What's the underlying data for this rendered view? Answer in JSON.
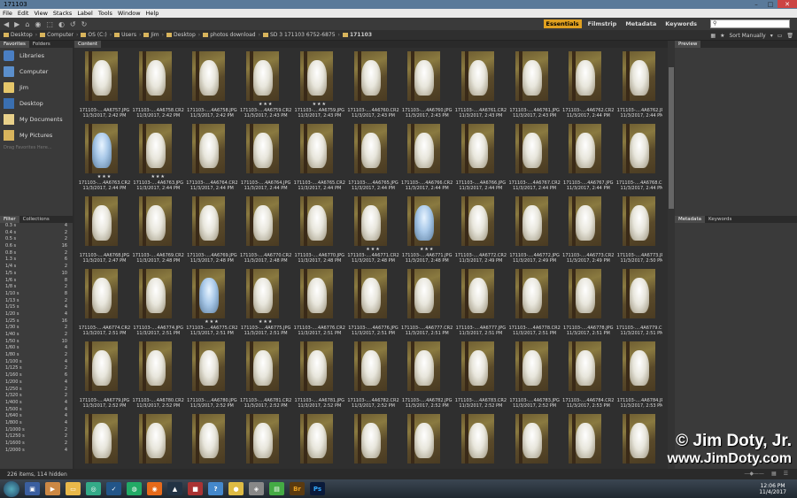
{
  "window": {
    "title": "171103"
  },
  "menu": [
    "File",
    "Edit",
    "View",
    "Stacks",
    "Label",
    "Tools",
    "Window",
    "Help"
  ],
  "workspaces": [
    "Essentials",
    "Filmstrip",
    "Metadata",
    "Keywords"
  ],
  "search": {
    "placeholder": ""
  },
  "path": [
    "Desktop",
    "Computer",
    "OS (C:)",
    "Users",
    "Jim",
    "Desktop",
    "photos download",
    "SD 3 171103 6752-6875",
    "171103"
  ],
  "view": {
    "sort": "Sort Manually"
  },
  "left_tabs": [
    "Favorites",
    "Folders"
  ],
  "favorites": [
    "Libraries",
    "Computer",
    "Jim",
    "Desktop",
    "My Documents",
    "My Pictures"
  ],
  "favorites_hint": "Drag Favorites Here...",
  "filter_tabs": [
    "Filter",
    "Collections"
  ],
  "filters": [
    [
      "0.3 s",
      "4"
    ],
    [
      "0.4 s",
      "2"
    ],
    [
      "0.5 s",
      "2"
    ],
    [
      "0.6 s",
      "16"
    ],
    [
      "0.8 s",
      "2"
    ],
    [
      "1.3 s",
      "6"
    ],
    [
      "1/4 s",
      "2"
    ],
    [
      "1/5 s",
      "10"
    ],
    [
      "1/6 s",
      "8"
    ],
    [
      "1/8 s",
      "2"
    ],
    [
      "1/10 s",
      "8"
    ],
    [
      "1/13 s",
      "2"
    ],
    [
      "1/15 s",
      "4"
    ],
    [
      "1/20 s",
      "4"
    ],
    [
      "1/25 s",
      "16"
    ],
    [
      "1/30 s",
      "2"
    ],
    [
      "1/40 s",
      "2"
    ],
    [
      "1/50 s",
      "10"
    ],
    [
      "1/60 s",
      "4"
    ],
    [
      "1/80 s",
      "2"
    ],
    [
      "1/100 s",
      "4"
    ],
    [
      "1/125 s",
      "2"
    ],
    [
      "1/160 s",
      "6"
    ],
    [
      "1/200 s",
      "4"
    ],
    [
      "1/250 s",
      "2"
    ],
    [
      "1/320 s",
      "2"
    ],
    [
      "1/400 s",
      "4"
    ],
    [
      "1/500 s",
      "4"
    ],
    [
      "1/640 s",
      "4"
    ],
    [
      "1/800 s",
      "4"
    ],
    [
      "1/1000 s",
      "2"
    ],
    [
      "1/1250 s",
      "2"
    ],
    [
      "1/1600 s",
      "2"
    ],
    [
      "1/2000 s",
      "4"
    ]
  ],
  "content_tab": "Content",
  "right_tabs_top": [
    "Preview"
  ],
  "right_tabs_bottom": [
    "Metadata",
    "Keywords"
  ],
  "thumbnails": [
    {
      "name": "171103-....4A6757.JPG",
      "date": "11/3/2017, 2:42 PM",
      "stars": ""
    },
    {
      "name": "171103-....4A6758.CR2",
      "date": "11/3/2017, 2:42 PM",
      "stars": ""
    },
    {
      "name": "171103-....4A6758.JPG",
      "date": "11/3/2017, 2:42 PM",
      "stars": ""
    },
    {
      "name": "171103-....4A6759.CR2",
      "date": "11/3/2017, 2:43 PM",
      "stars": "★★★"
    },
    {
      "name": "171103-....4A6759.JPG",
      "date": "11/3/2017, 2:43 PM",
      "stars": "★★★"
    },
    {
      "name": "171103-....4A6760.CR2",
      "date": "11/3/2017, 2:43 PM",
      "stars": ""
    },
    {
      "name": "171103-....4A6760.JPG",
      "date": "11/3/2017, 2:43 PM",
      "stars": ""
    },
    {
      "name": "171103-....4A6761.CR2",
      "date": "11/3/2017, 2:43 PM",
      "stars": ""
    },
    {
      "name": "171103-....4A6761.JPG",
      "date": "11/3/2017, 2:43 PM",
      "stars": ""
    },
    {
      "name": "171103-....4A6762.CR2",
      "date": "11/3/2017, 2:44 PM",
      "stars": ""
    },
    {
      "name": "171103-....4A6762.JPG",
      "date": "11/3/2017, 2:44 PM",
      "stars": ""
    },
    {
      "name": "171103-....4A6763.CR2",
      "date": "11/3/2017, 2:44 PM",
      "stars": "★★★"
    },
    {
      "name": "171103-....4A6763.JPG",
      "date": "11/3/2017, 2:44 PM",
      "stars": "★★★"
    },
    {
      "name": "171103-....4A6764.CR2",
      "date": "11/3/2017, 2:44 PM",
      "stars": ""
    },
    {
      "name": "171103-....4A6764.JPG",
      "date": "11/3/2017, 2:44 PM",
      "stars": ""
    },
    {
      "name": "171103-....4A6765.CR2",
      "date": "11/3/2017, 2:44 PM",
      "stars": ""
    },
    {
      "name": "171103-....4A6765.JPG",
      "date": "11/3/2017, 2:44 PM",
      "stars": ""
    },
    {
      "name": "171103-....4A6766.CR2",
      "date": "11/3/2017, 2:44 PM",
      "stars": ""
    },
    {
      "name": "171103-....4A6766.JPG",
      "date": "11/3/2017, 2:44 PM",
      "stars": ""
    },
    {
      "name": "171103-....4A6767.CR2",
      "date": "11/3/2017, 2:44 PM",
      "stars": ""
    },
    {
      "name": "171103-....4A6767.JPG",
      "date": "11/3/2017, 2:44 PM",
      "stars": ""
    },
    {
      "name": "171103-....4A6768.CR2",
      "date": "11/3/2017, 2:44 PM",
      "stars": ""
    },
    {
      "name": "171103-....4A6768.JPG",
      "date": "11/3/2017, 2:47 PM",
      "stars": ""
    },
    {
      "name": "171103-....4A6769.CR2",
      "date": "11/3/2017, 2:48 PM",
      "stars": ""
    },
    {
      "name": "171103-....4A6769.JPG",
      "date": "11/3/2017, 2:48 PM",
      "stars": ""
    },
    {
      "name": "171103-....4A6770.CR2",
      "date": "11/3/2017, 2:48 PM",
      "stars": ""
    },
    {
      "name": "171103-....4A6770.JPG",
      "date": "11/3/2017, 2:48 PM",
      "stars": ""
    },
    {
      "name": "171103-....4A6771.CR2",
      "date": "11/3/2017, 2:48 PM",
      "stars": "★★★"
    },
    {
      "name": "171103-....4A6771.JPG",
      "date": "11/3/2017, 2:48 PM",
      "stars": "★★★"
    },
    {
      "name": "171103-....4A6772.CR2",
      "date": "11/3/2017, 2:49 PM",
      "stars": ""
    },
    {
      "name": "171103-....4A6772.JPG",
      "date": "11/3/2017, 2:49 PM",
      "stars": ""
    },
    {
      "name": "171103-....4A6773.CR2",
      "date": "11/3/2017, 2:49 PM",
      "stars": ""
    },
    {
      "name": "171103-....4A6773.JPG",
      "date": "11/3/2017, 2:50 PM",
      "stars": ""
    },
    {
      "name": "171103-....4A6774.CR2",
      "date": "11/3/2017, 2:51 PM",
      "stars": ""
    },
    {
      "name": "171103-....4A6774.JPG",
      "date": "11/3/2017, 2:51 PM",
      "stars": ""
    },
    {
      "name": "171103-....4A6775.CR2",
      "date": "11/3/2017, 2:51 PM",
      "stars": "★★★"
    },
    {
      "name": "171103-....4A6775.JPG",
      "date": "11/3/2017, 2:51 PM",
      "stars": "★★★"
    },
    {
      "name": "171103-....4A6776.CR2",
      "date": "11/3/2017, 2:51 PM",
      "stars": ""
    },
    {
      "name": "171103-....4A6776.JPG",
      "date": "11/3/2017, 2:51 PM",
      "stars": ""
    },
    {
      "name": "171103-....4A6777.CR2",
      "date": "11/3/2017, 2:51 PM",
      "stars": ""
    },
    {
      "name": "171103-....4A6777.JPG",
      "date": "11/3/2017, 2:51 PM",
      "stars": ""
    },
    {
      "name": "171103-....4A6778.CR2",
      "date": "11/3/2017, 2:51 PM",
      "stars": ""
    },
    {
      "name": "171103-....4A6778.JPG",
      "date": "11/3/2017, 2:51 PM",
      "stars": ""
    },
    {
      "name": "171103-....4A6779.CR2",
      "date": "11/3/2017, 2:51 PM",
      "stars": ""
    },
    {
      "name": "171103-....4A6779.JPG",
      "date": "11/3/2017, 2:52 PM",
      "stars": ""
    },
    {
      "name": "171103-....4A6780.CR2",
      "date": "11/3/2017, 2:52 PM",
      "stars": ""
    },
    {
      "name": "171103-....4A6780.JPG",
      "date": "11/3/2017, 2:52 PM",
      "stars": ""
    },
    {
      "name": "171103-....4A6781.CR2",
      "date": "11/3/2017, 2:52 PM",
      "stars": ""
    },
    {
      "name": "171103-....4A6781.JPG",
      "date": "11/3/2017, 2:52 PM",
      "stars": ""
    },
    {
      "name": "171103-....4A6782.CR2",
      "date": "11/3/2017, 2:52 PM",
      "stars": ""
    },
    {
      "name": "171103-....4A6782.JPG",
      "date": "11/3/2017, 2:52 PM",
      "stars": ""
    },
    {
      "name": "171103-....4A6783.CR2",
      "date": "11/3/2017, 2:52 PM",
      "stars": ""
    },
    {
      "name": "171103-....4A6783.JPG",
      "date": "11/3/2017, 2:52 PM",
      "stars": ""
    },
    {
      "name": "171103-....4A6784.CR2",
      "date": "11/3/2017, 2:53 PM",
      "stars": ""
    },
    {
      "name": "171103-....4A6784.JPG",
      "date": "11/3/2017, 2:53 PM",
      "stars": ""
    },
    {
      "name": "",
      "date": "",
      "stars": ""
    },
    {
      "name": "",
      "date": "",
      "stars": ""
    },
    {
      "name": "",
      "date": "",
      "stars": ""
    },
    {
      "name": "",
      "date": "",
      "stars": ""
    },
    {
      "name": "",
      "date": "",
      "stars": ""
    },
    {
      "name": "",
      "date": "",
      "stars": ""
    },
    {
      "name": "",
      "date": "",
      "stars": ""
    },
    {
      "name": "",
      "date": "",
      "stars": ""
    },
    {
      "name": "",
      "date": "",
      "stars": ""
    },
    {
      "name": "",
      "date": "",
      "stars": ""
    },
    {
      "name": "",
      "date": "",
      "stars": ""
    }
  ],
  "blue_thumbs": [
    11,
    28,
    35
  ],
  "status": "226 items, 114 hidden",
  "clock": {
    "time": "12:06 PM",
    "date": "11/4/2017"
  },
  "watermark": {
    "line1": "© Jim Doty, Jr.",
    "line2": "www.JimDoty.com"
  }
}
